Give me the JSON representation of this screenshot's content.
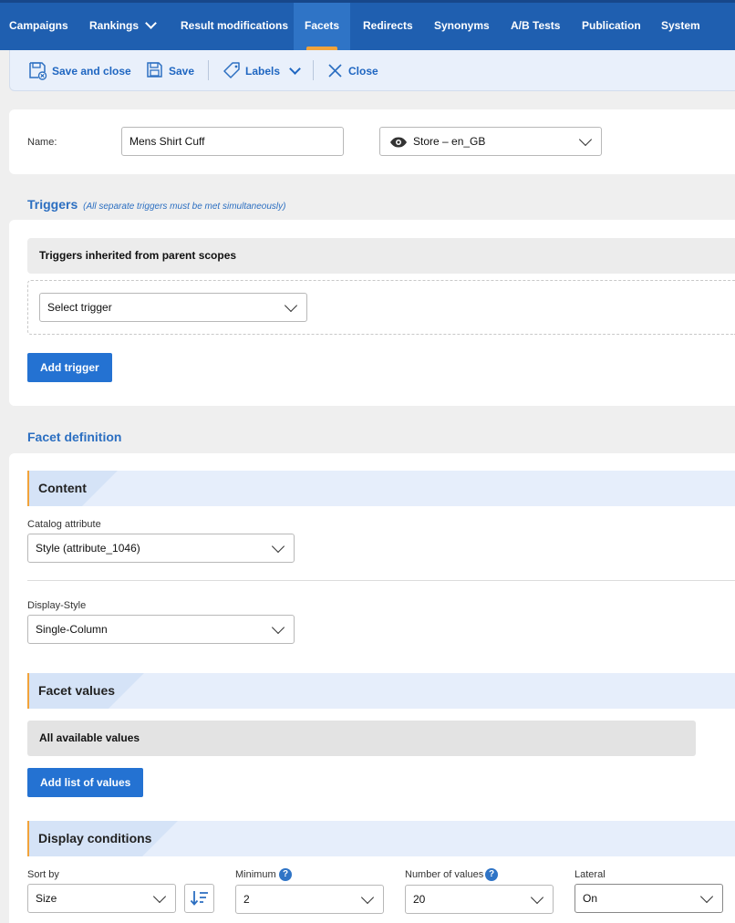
{
  "nav": {
    "items": [
      {
        "label": "Campaigns"
      },
      {
        "label": "Rankings"
      },
      {
        "label": "Result modifications"
      },
      {
        "label": "Facets"
      },
      {
        "label": "Redirects"
      },
      {
        "label": "Synonyms"
      },
      {
        "label": "A/B Tests"
      },
      {
        "label": "Publication"
      },
      {
        "label": "System"
      }
    ],
    "active": "Facets"
  },
  "toolbar": {
    "save_close_label": "Save and close",
    "save_label": "Save",
    "labels_label": "Labels",
    "close_label": "Close"
  },
  "form": {
    "name_label": "Name:",
    "name_value": "Mens Shirt Cuff",
    "scope_value": "Store – en_GB"
  },
  "triggers": {
    "title": "Triggers",
    "hint": "(All separate triggers must be met simultaneously)",
    "inherited_label": "Triggers inherited from parent scopes",
    "select_value": "Select trigger",
    "add_button": "Add trigger"
  },
  "facet_definition": {
    "title": "Facet definition",
    "content": {
      "title": "Content",
      "catalog_label": "Catalog attribute",
      "catalog_value": "Style (attribute_1046)",
      "display_label": "Display-Style",
      "display_value": "Single-Column"
    },
    "facet_values": {
      "title": "Facet values",
      "all_values": "All available values",
      "add_button": "Add list of values"
    },
    "display_conditions": {
      "title": "Display conditions",
      "sort_label": "Sort by",
      "sort_value": "Size",
      "minimum_label": "Minimum",
      "minimum_value": "2",
      "number_label": "Number of values",
      "number_value": "20",
      "lateral_label": "Lateral",
      "lateral_value": "On"
    }
  },
  "colors": {
    "nav_bg": "#1f5fb0",
    "accent": "#2472d2",
    "highlight": "#f2a33a"
  }
}
